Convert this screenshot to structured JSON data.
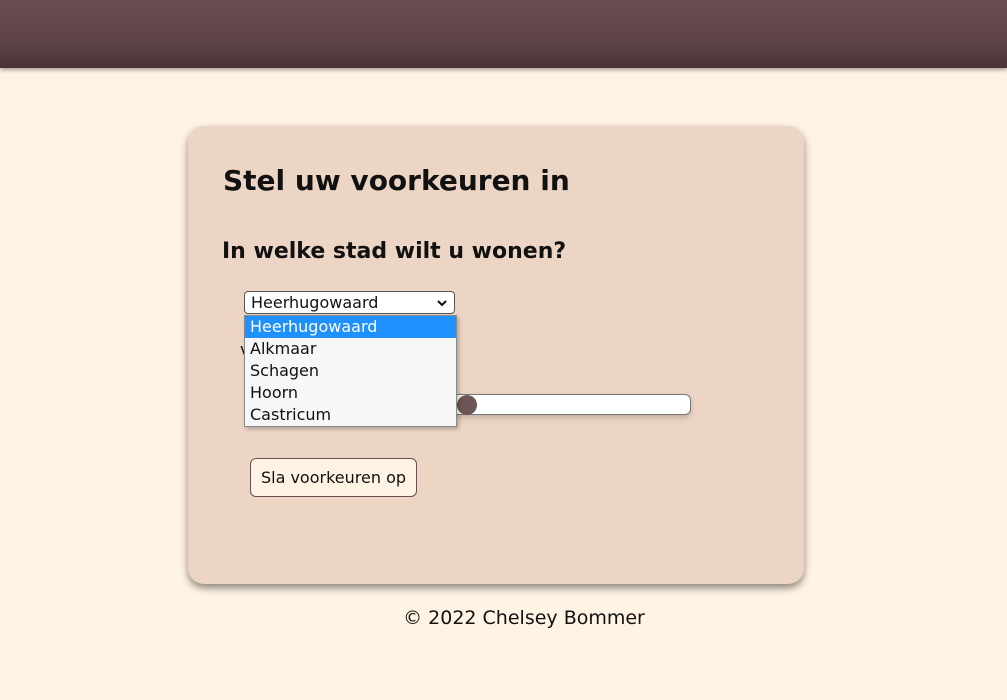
{
  "page": {
    "title": "Stel uw voorkeuren in",
    "question": "In welke stad wilt u wonen?",
    "hidden_label_fragment": "v"
  },
  "city_select": {
    "selected": "Heerhugowaard",
    "options": [
      "Heerhugowaard",
      "Alkmaar",
      "Schagen",
      "Hoorn",
      "Castricum"
    ]
  },
  "slider": {
    "value_fraction": 0.07
  },
  "actions": {
    "save_label": "Sla voorkeuren op"
  },
  "footer": {
    "text": "© 2022 Chelsey Bommer"
  },
  "colors": {
    "header": "#5e4346",
    "background": "#fff3e3",
    "card": "#ecd5c4",
    "accent": "#6e5556",
    "highlight": "#1e90ff"
  }
}
